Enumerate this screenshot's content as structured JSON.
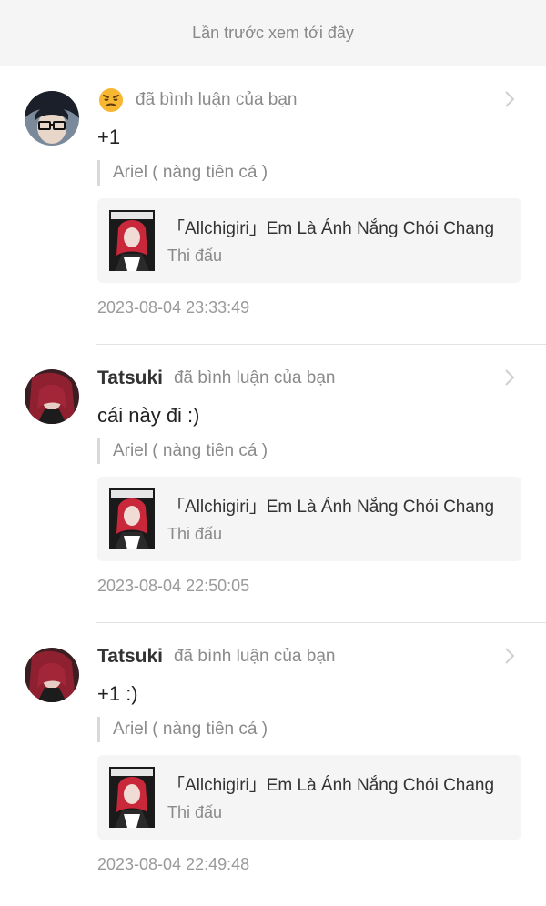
{
  "banner": {
    "text": "Lần trước xem tới đây"
  },
  "notifications": [
    {
      "username": "",
      "emoji": "angry-emoji-icon",
      "action": "đã bình luận của bạn",
      "comment": "+1",
      "quote": "Ariel ( nàng tiên cá )",
      "story_title": "「Allchigiri」Em Là Ánh Nắng Chói Chang",
      "story_category": "Thi đấu",
      "timestamp": "2023-08-04 23:33:49"
    },
    {
      "username": "Tatsuki",
      "action": "đã bình luận của bạn",
      "comment": "cái này đi :)",
      "quote": "Ariel ( nàng tiên cá )",
      "story_title": "「Allchigiri」Em Là Ánh Nắng Chói Chang",
      "story_category": "Thi đấu",
      "timestamp": "2023-08-04 22:50:05"
    },
    {
      "username": "Tatsuki",
      "action": "đã bình luận của bạn",
      "comment": "+1 :)",
      "quote": "Ariel ( nàng tiên cá )",
      "story_title": "「Allchigiri」Em Là Ánh Nắng Chói Chang",
      "story_category": "Thi đấu",
      "timestamp": "2023-08-04 22:49:48"
    }
  ],
  "colors": {
    "muted": "#8a8a8a",
    "card_bg": "#f5f5f5",
    "banner_bg": "#f5f5f5"
  }
}
